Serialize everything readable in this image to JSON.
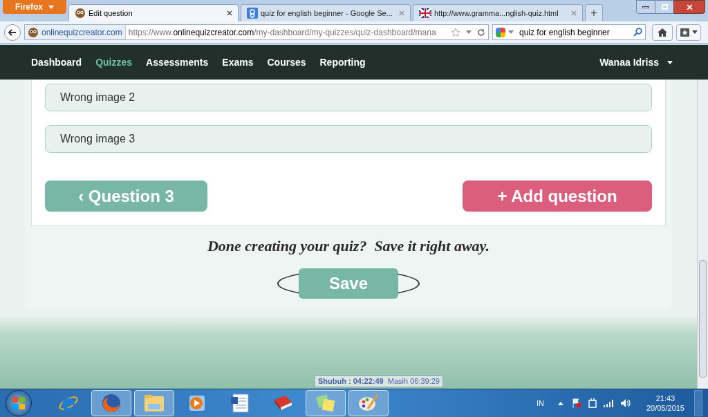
{
  "browser": {
    "menu_button": "Firefox",
    "tabs": [
      {
        "title": "Edit question",
        "selected": true
      },
      {
        "title": "quiz for english beginner - Google Se...",
        "selected": false
      },
      {
        "title": "http://www.gramma...nglish-quiz.html",
        "selected": false
      }
    ],
    "new_tab": "+",
    "site": "onlinequizcreator.com",
    "url_prefix": "https://www.",
    "url_domain": "onlinequizcreator.com",
    "url_path": "/my-dashboard/my-quizzes/quiz-dashboard/mana",
    "search": "quiz for english beginner"
  },
  "site_nav": {
    "items": [
      {
        "label": "Dashboard",
        "selected": false
      },
      {
        "label": "Quizzes",
        "selected": true
      },
      {
        "label": "Assessments",
        "selected": false
      },
      {
        "label": "Exams",
        "selected": false
      },
      {
        "label": "Courses",
        "selected": false
      },
      {
        "label": "Reporting",
        "selected": false
      }
    ],
    "user": "Wanaa Idriss"
  },
  "answers": [
    "Wrong image 2",
    "Wrong image 3"
  ],
  "prev_button": "‹ Question 3",
  "add_button": "+ Add question",
  "prompt": "Done creating your quiz?  Save it right away.",
  "save_button": "Save",
  "prayer": {
    "label": "Shubuh : 04:22:49",
    "remaining": "Masih 06:39:29"
  },
  "taskbar": {
    "apps": [
      {
        "kind": "ie",
        "open": false
      },
      {
        "kind": "firefox",
        "open": true
      },
      {
        "kind": "explorer",
        "open": true
      },
      {
        "kind": "media",
        "open": false
      },
      {
        "kind": "word",
        "open": false
      },
      {
        "kind": "book",
        "open": false
      },
      {
        "kind": "notes",
        "open": true
      },
      {
        "kind": "paint",
        "open": true
      }
    ],
    "language": "IN",
    "time": "21:43",
    "date": "20/05/2015"
  }
}
